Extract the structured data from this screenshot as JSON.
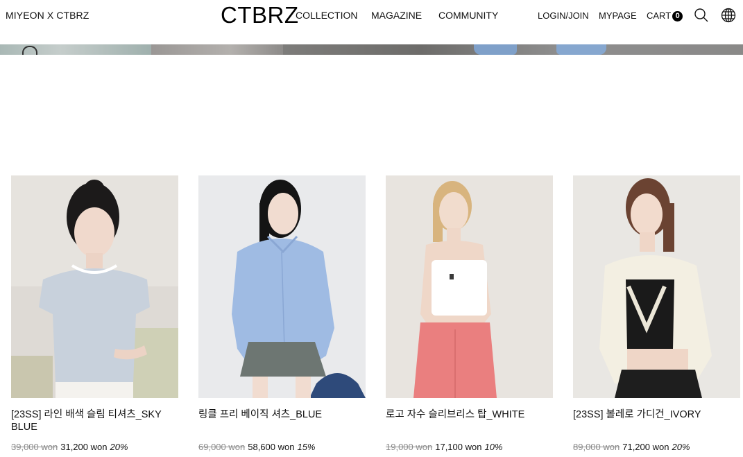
{
  "header": {
    "collab": "MIYEON X CTBRZ",
    "logo": "CTBRZ",
    "nav": {
      "collection": "COLLECTION",
      "magazine": "MAGAZINE",
      "community": "COMMUNITY"
    },
    "util": {
      "login": "LOGIN/JOIN",
      "mypage": "MYPAGE",
      "cart": "CART",
      "cart_count": "0"
    },
    "icons": [
      "search-icon",
      "globe-icon"
    ]
  },
  "products": [
    {
      "name": "[23SS] 라인 배색 슬림 티셔츠_SKY BLUE",
      "original_price": "39,000 won",
      "sale_price": "31,200 won",
      "discount": "20%"
    },
    {
      "name": "링클 프리 베이직 셔츠_BLUE",
      "original_price": "69,000 won",
      "sale_price": "58,600 won",
      "discount": "15%"
    },
    {
      "name": "로고 자수 슬리브리스 탑_WHITE",
      "original_price": "19,000 won",
      "sale_price": "17,100 won",
      "discount": "10%"
    },
    {
      "name": "[23SS] 볼레로 가디건_IVORY",
      "original_price": "89,000 won",
      "sale_price": "71,200 won",
      "discount": "20%"
    }
  ],
  "colors": {
    "text": "#111111",
    "strikethrough": "#8a8a8a",
    "background": "#ffffff"
  }
}
